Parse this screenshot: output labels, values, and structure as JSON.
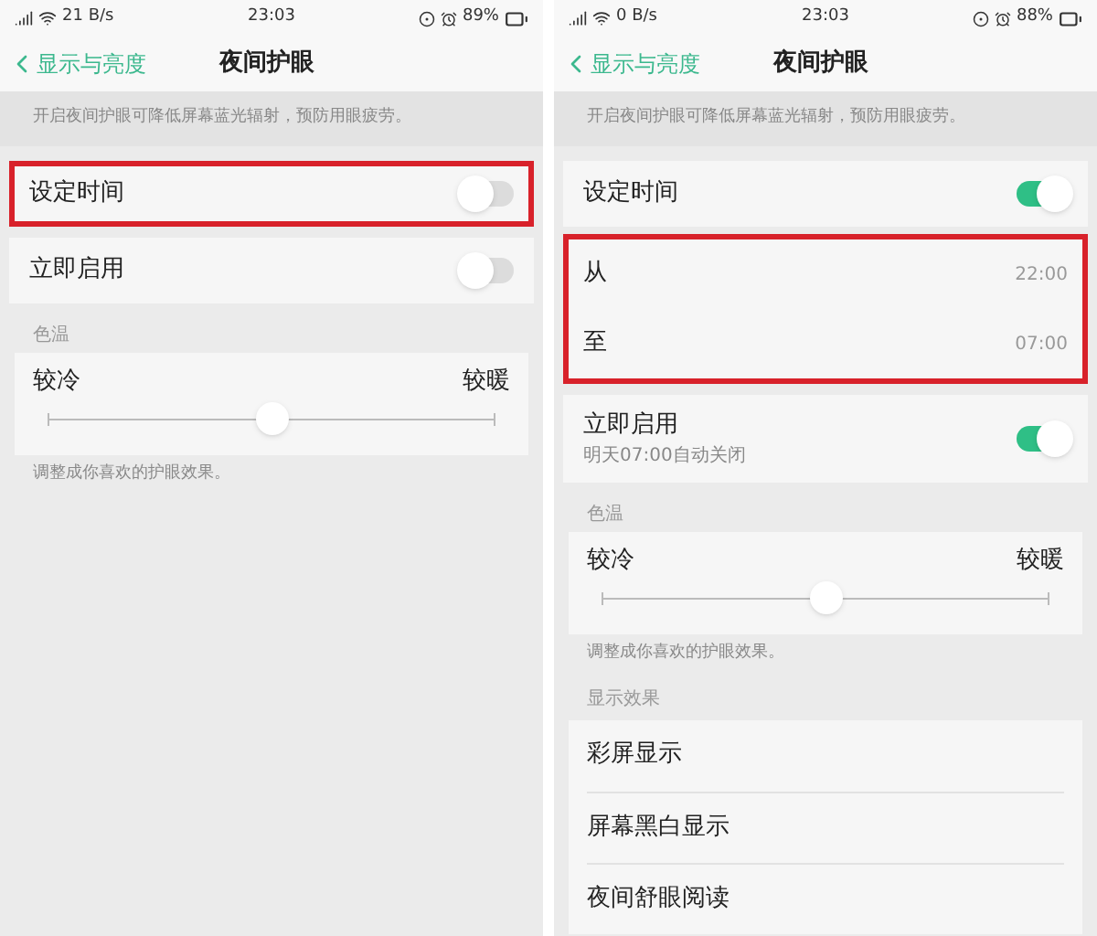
{
  "panels": [
    {
      "status_bar": {
        "speed": "21 B/s",
        "time": "23:03",
        "battery": "89%"
      },
      "header": {
        "back": "显示与亮度",
        "title": "夜间护眼"
      },
      "intro": "开启夜间护眼可降低屏幕蓝光辐射，预防用眼疲劳。",
      "items": [
        {
          "kind": "toggle",
          "label": "设定时间",
          "on": false,
          "highlighted": true
        },
        {
          "kind": "toggle",
          "label": "立即启用",
          "on": false,
          "highlighted": false
        },
        {
          "kind": "section",
          "label": "色温"
        },
        {
          "kind": "slider",
          "min_label": "较冷",
          "max_label": "较暖",
          "level": 0.5
        },
        {
          "kind": "note",
          "text": "调整成你喜欢的护眼效果。"
        }
      ]
    },
    {
      "status_bar": {
        "speed": "0 B/s",
        "time": "23:03",
        "battery": "88%"
      },
      "header": {
        "back": "显示与亮度",
        "title": "夜间护眼"
      },
      "intro": "开启夜间护眼可降低屏幕蓝光辐射，预防用眼疲劳。",
      "items": [
        {
          "kind": "toggle",
          "label": "设定时间",
          "on": true,
          "highlighted": false
        },
        {
          "kind": "times",
          "highlighted": true,
          "rows": [
            {
              "label": "从",
              "value": "22:00"
            },
            {
              "label": "至",
              "value": "07:00"
            }
          ]
        },
        {
          "kind": "toggle",
          "label": "立即启用",
          "subtitle": "明天07:00自动关闭",
          "on": true,
          "highlighted": false
        },
        {
          "kind": "section",
          "label": "色温"
        },
        {
          "kind": "slider",
          "min_label": "较冷",
          "max_label": "较暖",
          "level": 0.5
        },
        {
          "kind": "note",
          "text": "调整成你喜欢的护眼效果。"
        },
        {
          "kind": "section",
          "label": "显示效果"
        },
        {
          "kind": "options",
          "rows": [
            "彩屏显示",
            "屏幕黑白显示",
            "夜间舒眼阅读"
          ]
        }
      ]
    }
  ]
}
